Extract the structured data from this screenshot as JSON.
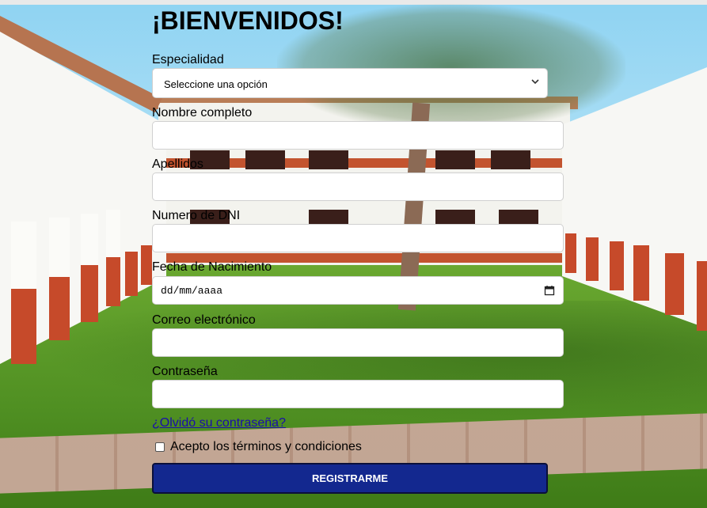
{
  "page": {
    "title": "¡BIENVENIDOS!"
  },
  "form": {
    "especialidad": {
      "label": "Especialidad",
      "selected": "Seleccione una opción",
      "icon": "chevron-down-icon"
    },
    "nombre": {
      "label": "Nombre completo",
      "value": ""
    },
    "apellidos": {
      "label": "Apellidos",
      "value": ""
    },
    "dni": {
      "label": "Numero de DNI",
      "value": ""
    },
    "fecha": {
      "label": "Fecha de Nacimiento",
      "placeholder": "dd/mm/aaaa",
      "icon": "calendar-icon"
    },
    "correo": {
      "label": "Correo electrónico",
      "value": ""
    },
    "contrasena": {
      "label": "Contraseña",
      "value": ""
    },
    "forgot_link": "¿Olvidó su contraseña?",
    "terms": {
      "label": "Acepto los términos y condiciones",
      "checked": false
    },
    "submit_label": "REGISTRARME"
  },
  "colors": {
    "button_bg": "#13288f",
    "link": "#1a0dab"
  }
}
